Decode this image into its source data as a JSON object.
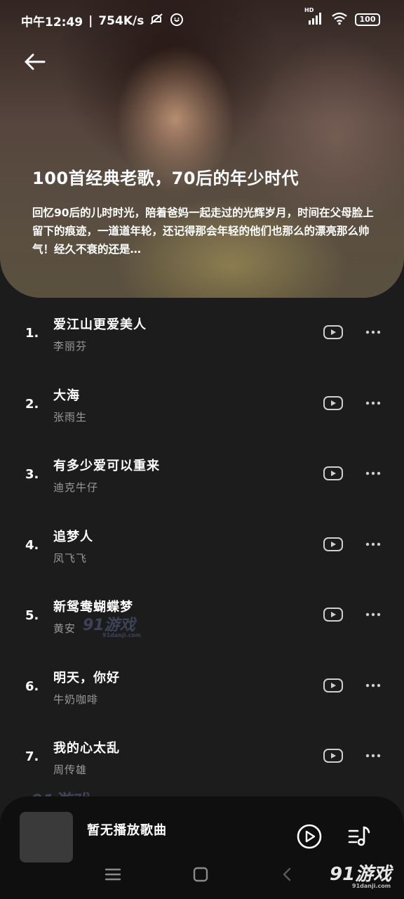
{
  "status_bar": {
    "time": "中午12:49",
    "separator": "|",
    "speed": "754K/s",
    "battery": "100",
    "signal_label": "HD"
  },
  "header": {
    "title": "100首经典老歌，70后的年少时代",
    "description": "回忆90后的儿时时光，陪着爸妈一起走过的光辉岁月，时间在父母脸上留下的痕迹，一道道年轮，还记得那会年轻的他们也那么的漂亮那么帅气！经久不衰的还是…"
  },
  "songs": [
    {
      "index": "1.",
      "title": "爱江山更爱美人",
      "artist": "李丽芬"
    },
    {
      "index": "2.",
      "title": "大海",
      "artist": "张雨生"
    },
    {
      "index": "3.",
      "title": "有多少爱可以重来",
      "artist": "迪克牛仔"
    },
    {
      "index": "4.",
      "title": "追梦人",
      "artist": "凤飞飞"
    },
    {
      "index": "5.",
      "title": "新鸳鸯蝴蝶梦",
      "artist": "黄安"
    },
    {
      "index": "6.",
      "title": "明天，你好",
      "artist": "牛奶咖啡"
    },
    {
      "index": "7.",
      "title": "我的心太乱",
      "artist": "周传雄"
    }
  ],
  "player": {
    "now_playing": "暂无播放歌曲"
  },
  "watermark": {
    "brand": "91游戏",
    "url": "91danji.com"
  },
  "icons": {
    "back": "arrow-left-icon",
    "play_video": "video-play-icon",
    "more": "more-dots-icon",
    "player_play": "circle-play-icon",
    "queue": "playlist-music-icon",
    "nav_menu": "menu-icon",
    "nav_home": "home-square-icon",
    "nav_back": "nav-back-icon"
  }
}
